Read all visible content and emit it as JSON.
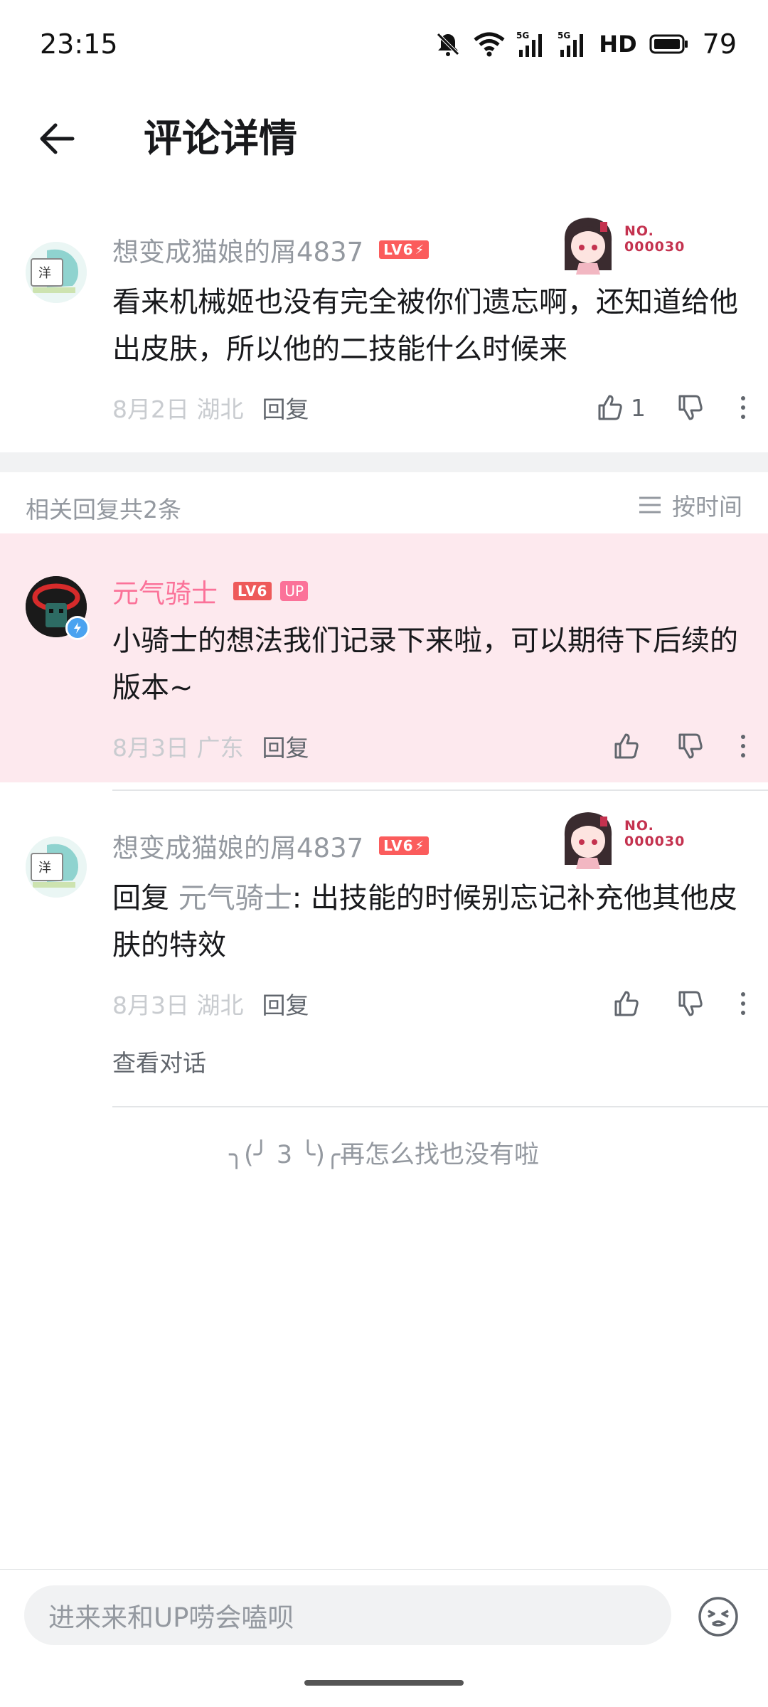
{
  "status_bar": {
    "time": "23:15",
    "battery": "79",
    "network_label": "HD"
  },
  "header": {
    "title": "评论详情"
  },
  "main_comment": {
    "username": "想变成猫娘的屑4837",
    "level": "LV6",
    "fan_badge_number": "NO.\n000030",
    "content": "看来机械姬也没有完全被你们遗忘啊，还知道给他出皮肤，所以他的二技能什么时候来",
    "date": "8月2日",
    "location": "湖北",
    "reply_label": "回复",
    "like_count": "1"
  },
  "replies_header": {
    "count_text": "相关回复共2条",
    "sort_label": "按时间"
  },
  "replies": [
    {
      "username": "元气骑士",
      "level": "LV6",
      "up_badge": "UP",
      "content": "小骑士的想法我们记录下来啦，可以期待下后续的版本~",
      "date": "8月3日",
      "location": "广东",
      "reply_label": "回复"
    },
    {
      "username": "想变成猫娘的屑4837",
      "level": "LV6",
      "fan_badge_number": "NO.\n000030",
      "reply_prefix": "回复 ",
      "reply_to": "元气骑士",
      "content": ": 出技能的时候别忘记补充他其他皮肤的特效",
      "date": "8月3日",
      "location": "湖北",
      "reply_label": "回复",
      "view_convo": "查看对话"
    }
  ],
  "end_text": "╮(╯ 3 ╰)╭再怎么找也没有啦",
  "input": {
    "placeholder": "进来来和UP唠会嗑呗"
  },
  "colors": {
    "accent_pink": "#fb7299",
    "highlight_bg": "#fde9ee",
    "level_red": "#ee5a5a"
  }
}
